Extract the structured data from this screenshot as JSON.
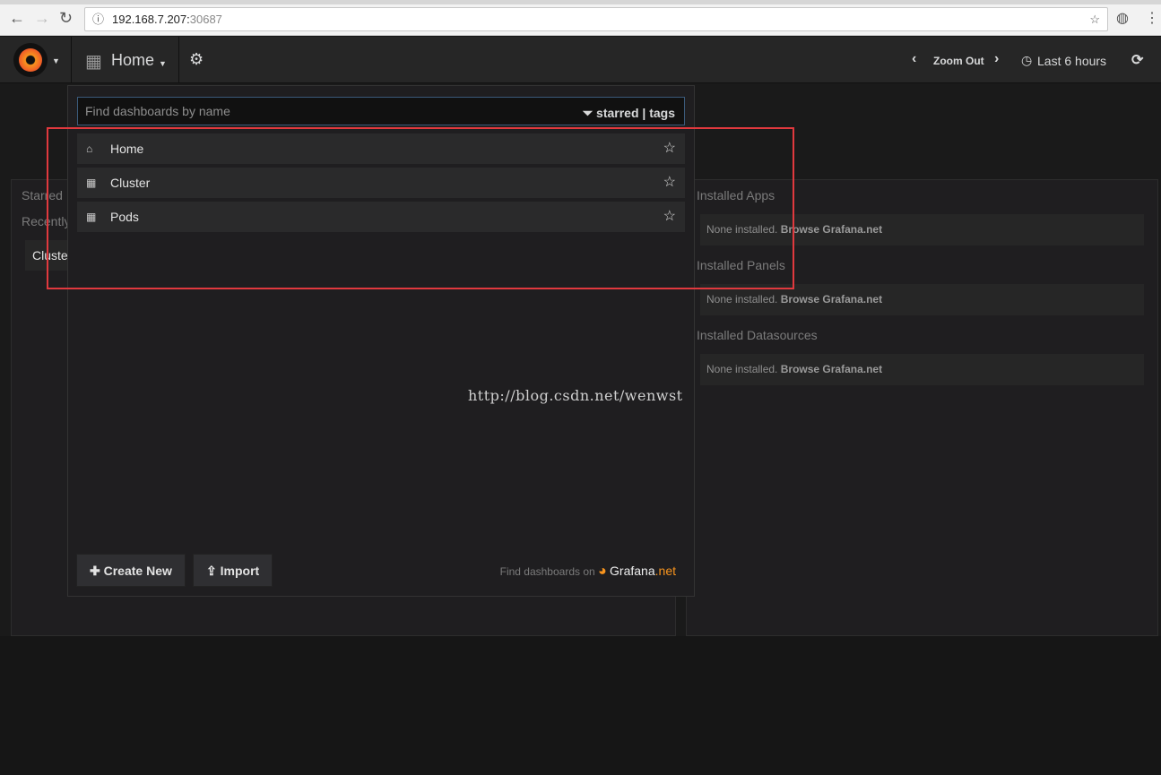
{
  "browser": {
    "url_host": "192.168.7.207:",
    "url_port": "30687"
  },
  "navbar": {
    "dashboard_title": "Home",
    "zoom_out": "Zoom Out",
    "time_range": "Last 6 hours"
  },
  "left_panel": {
    "starred": "Starred",
    "recently": "Recently",
    "recent_item": "Cluster"
  },
  "right_panel": {
    "sections": [
      {
        "title": "Installed Apps",
        "text": "None installed.",
        "link": "Browse Grafana.net"
      },
      {
        "title": "Installed Panels",
        "text": "None installed.",
        "link": "Browse Grafana.net"
      },
      {
        "title": "Installed Datasources",
        "text": "None installed.",
        "link": "Browse Grafana.net"
      }
    ]
  },
  "search": {
    "placeholder": "Find dashboards by name",
    "filter": "starred | tags",
    "results": [
      {
        "label": "Home",
        "icon": "home-icon"
      },
      {
        "label": "Cluster",
        "icon": "dashboard-grid-icon"
      },
      {
        "label": "Pods",
        "icon": "dashboard-grid-icon"
      }
    ],
    "create_new": "Create New",
    "import": "Import",
    "find_on": "Find dashboards on",
    "grafana_net_a": "Grafana",
    "grafana_net_b": ".net"
  },
  "watermark": "http://blog.csdn.net/wenwst",
  "colors": {
    "highlight": "#e0393e",
    "accent": "#f7941e"
  }
}
